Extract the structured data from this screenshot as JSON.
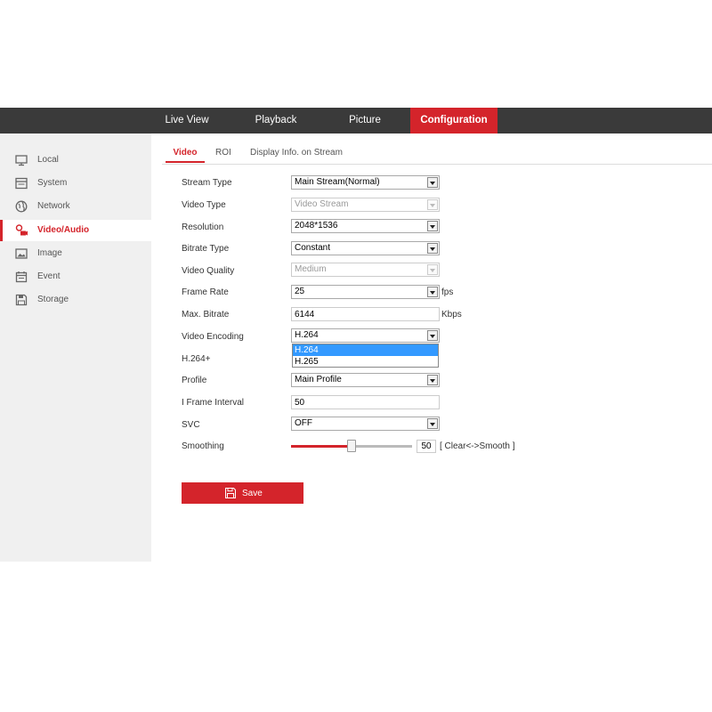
{
  "nav": {
    "items": [
      "Live View",
      "Playback",
      "Picture",
      "Configuration"
    ],
    "active": "Configuration"
  },
  "sidebar": {
    "items": [
      {
        "label": "Local",
        "icon": "monitor-icon"
      },
      {
        "label": "System",
        "icon": "system-icon"
      },
      {
        "label": "Network",
        "icon": "globe-icon"
      },
      {
        "label": "Video/Audio",
        "icon": "video-audio-icon"
      },
      {
        "label": "Image",
        "icon": "image-icon"
      },
      {
        "label": "Event",
        "icon": "event-icon"
      },
      {
        "label": "Storage",
        "icon": "storage-icon"
      }
    ],
    "active": "Video/Audio"
  },
  "tabs": {
    "items": [
      "Video",
      "ROI",
      "Display Info. on Stream"
    ],
    "active": "Video"
  },
  "form": {
    "stream_type": {
      "label": "Stream Type",
      "value": "Main Stream(Normal)"
    },
    "video_type": {
      "label": "Video Type",
      "value": "Video Stream"
    },
    "resolution": {
      "label": "Resolution",
      "value": "2048*1536"
    },
    "bitrate_type": {
      "label": "Bitrate Type",
      "value": "Constant"
    },
    "video_quality": {
      "label": "Video Quality",
      "value": "Medium"
    },
    "frame_rate": {
      "label": "Frame Rate",
      "value": "25",
      "unit": "fps"
    },
    "max_bitrate": {
      "label": "Max. Bitrate",
      "value": "6144",
      "unit": "Kbps"
    },
    "video_encoding": {
      "label": "Video Encoding",
      "value": "H.264",
      "options": [
        "H.264",
        "H.265"
      ],
      "highlighted": "H.264"
    },
    "h264_plus": {
      "label": "H.264+"
    },
    "profile": {
      "label": "Profile",
      "value": "Main Profile"
    },
    "i_frame_interval": {
      "label": "I Frame Interval",
      "value": "50"
    },
    "svc": {
      "label": "SVC",
      "value": "OFF"
    },
    "smoothing": {
      "label": "Smoothing",
      "value": "50",
      "level": 0.5,
      "range_label": "[ Clear<->Smooth ]"
    }
  },
  "save": {
    "label": "Save",
    "icon": "floppy-disk-icon"
  },
  "colors": {
    "accent": "#d4242b",
    "topbar": "#3a3a3a",
    "sidebar": "#f0f0f0",
    "highlight": "#3399ff"
  }
}
